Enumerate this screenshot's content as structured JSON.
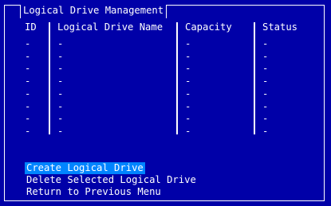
{
  "window": {
    "title": "Logical Drive Management"
  },
  "table": {
    "headers": [
      "ID",
      "Logical Drive Name",
      "Capacity",
      "Status"
    ],
    "rows": [
      [
        "-",
        "-",
        "-",
        "-"
      ],
      [
        "-",
        "-",
        "-",
        "-"
      ],
      [
        "-",
        "-",
        "-",
        "-"
      ],
      [
        "-",
        "-",
        "-",
        "-"
      ],
      [
        "-",
        "-",
        "-",
        "-"
      ],
      [
        "-",
        "-",
        "-",
        "-"
      ],
      [
        "-",
        "-",
        "-",
        "-"
      ],
      [
        "-",
        "-",
        "-",
        "-"
      ]
    ]
  },
  "menu": {
    "items": [
      {
        "label": "Create Logical Drive",
        "selected": true
      },
      {
        "label": "Delete Selected Logical Drive",
        "selected": false
      },
      {
        "label": "Return to Previous Menu",
        "selected": false
      }
    ]
  },
  "colors": {
    "background": "#0000a8",
    "foreground": "#ffffff",
    "highlight": "#0084ff"
  }
}
